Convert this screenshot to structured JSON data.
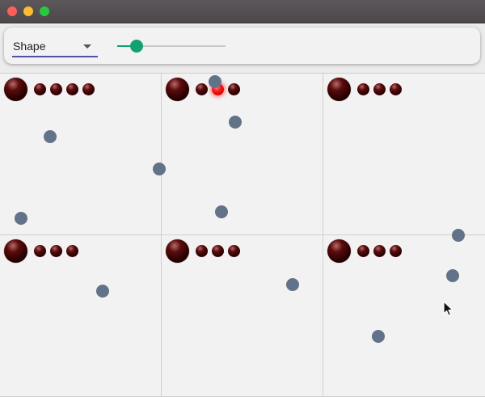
{
  "toolbar": {
    "shape_select_value": "Shape",
    "slider_value_fraction": 0.18,
    "accent_color": "#13a073",
    "underline_color": "#4a55a8"
  },
  "colors": {
    "dot": "#627288",
    "ball_active": "#ff1e1e",
    "ball": "#2a0000"
  },
  "cells": [
    {
      "small_balls": 4,
      "active_index": -1
    },
    {
      "small_balls": 3,
      "active_index": 1
    },
    {
      "small_balls": 3,
      "active_index": -1
    },
    {
      "small_balls": 3,
      "active_index": -1
    },
    {
      "small_balls": 3,
      "active_index": -1
    },
    {
      "small_balls": 3,
      "active_index": -1
    }
  ]
}
